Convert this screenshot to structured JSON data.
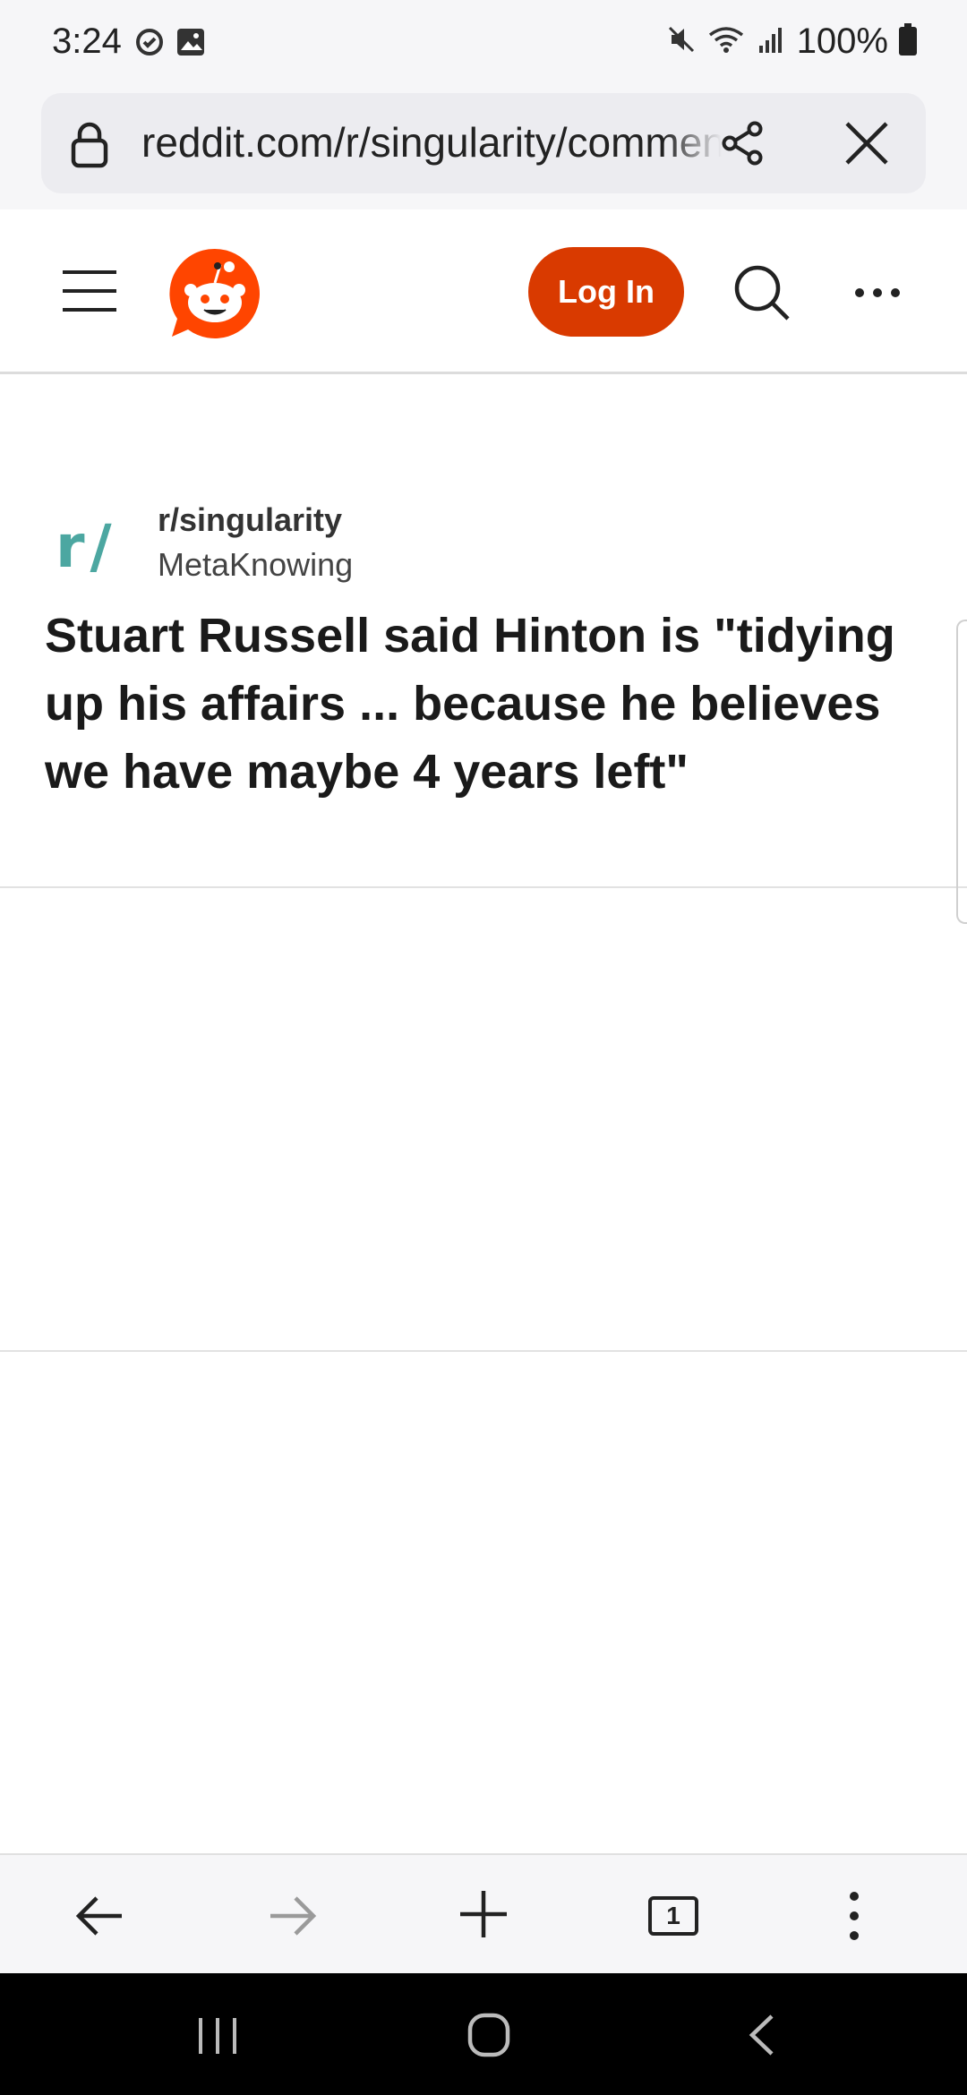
{
  "status_bar": {
    "time": "3:24",
    "battery": "100%",
    "icons": [
      "sync-icon",
      "image-icon",
      "mute-icon",
      "wifi-icon",
      "signal-icon",
      "battery-icon"
    ]
  },
  "browser": {
    "url": "reddit.com/r/singularity/comments",
    "icons": [
      "lock-icon",
      "share-icon",
      "close-icon"
    ]
  },
  "header": {
    "login_label": "Log In",
    "brand_color": "#d93a00",
    "icons": [
      "hamburger-icon",
      "reddit-logo-icon",
      "search-icon",
      "more-icon"
    ]
  },
  "post": {
    "subreddit_icon": "r/",
    "subreddit": "r/singularity",
    "author": "MetaKnowing",
    "title": "Stuart Russell said Hinton is \"tidying up his affairs ... because he believes we have maybe 4 years left\""
  },
  "toolbar": {
    "tabs_count": "1",
    "icons": [
      "back-arrow-icon",
      "forward-arrow-icon",
      "plus-icon",
      "tabs-icon",
      "kebab-menu-icon"
    ]
  },
  "nav": {
    "icons": [
      "recent-apps-icon",
      "home-icon",
      "nav-back-icon"
    ]
  }
}
